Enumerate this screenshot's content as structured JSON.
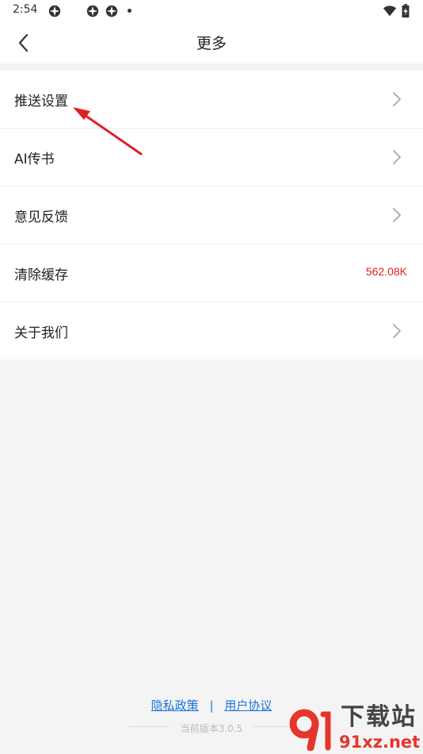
{
  "status_bar": {
    "time": "2:54"
  },
  "header": {
    "title": "更多",
    "back_icon": "chevron-left-icon"
  },
  "menu": {
    "items": [
      {
        "label": "推送设置",
        "trailing": "chevron-right-icon"
      },
      {
        "label": "AI传书",
        "trailing": "chevron-right-icon"
      },
      {
        "label": "意见反馈",
        "trailing": "chevron-right-icon"
      },
      {
        "label": "清除缓存",
        "value": "562.08K"
      },
      {
        "label": "关于我们",
        "trailing": "chevron-right-icon"
      }
    ]
  },
  "footer": {
    "privacy_link": "隐私政策",
    "separator": "|",
    "terms_link": "用户协议",
    "version": "当前版本3.0.5"
  },
  "watermark": {
    "brand": "下载站",
    "domain": "91xz.net"
  },
  "colors": {
    "background": "#f4f4f4",
    "link": "#1a73d9",
    "cache_value": "#e02020",
    "annotation_arrow": "#e02020",
    "version_text": "#bbbbbb",
    "watermark_red": "#e5362b"
  }
}
